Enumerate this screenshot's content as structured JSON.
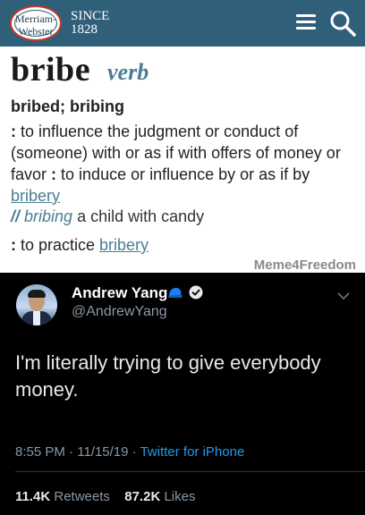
{
  "dictionary": {
    "logo_line1": "Merriam-",
    "logo_line2": "Webster",
    "since_label": "SINCE",
    "since_year": "1828",
    "headword": "bribe",
    "part_of_speech": "verb",
    "inflections": "bribed; bribing",
    "def1_colon": ":",
    "def1_text": " to influence the judgment or conduct of (someone) with or as if with offers of money or favor ",
    "def2_colon": ":",
    "def2_text": " to induce or influence by or as if by ",
    "def2_link": "bribery",
    "example_slashes": "//",
    "example_em": "bribing",
    "example_rest": " a child with candy",
    "def3_colon": ":",
    "def3_text": " to practice ",
    "def3_link": "bribery",
    "watermark": "Meme4Freedom",
    "colors": {
      "header_bg": "#305f7a",
      "accent": "#4a7d95",
      "logo_ring": "#c0392b"
    }
  },
  "tweet": {
    "display_name": "Andrew Yang",
    "handle": "@AndrewYang",
    "name_emoji_icon": "blue-cap-emoji-icon",
    "verified_icon": "verified-badge-icon",
    "text": "I'm literally trying to give everybody money.",
    "time": "8:55 PM",
    "date": "11/15/19",
    "separator": "·",
    "source": "Twitter for iPhone",
    "retweets_count": "11.4K",
    "retweets_label": "Retweets",
    "likes_count": "87.2K",
    "likes_label": "Likes",
    "colors": {
      "background": "#000000",
      "link": "#1d9bf0",
      "muted": "#8b98a5"
    }
  }
}
